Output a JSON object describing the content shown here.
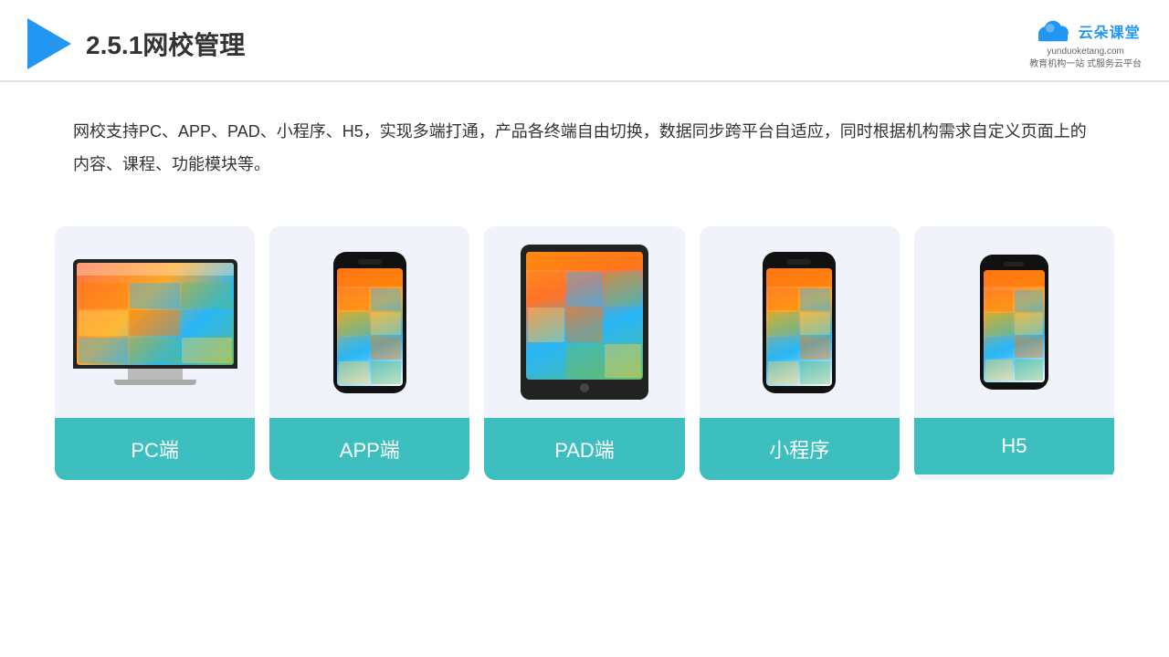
{
  "header": {
    "title": "2.5.1网校管理",
    "brand": {
      "name": "云朵课堂",
      "domain": "yunduoketang.com",
      "tagline": "教育机构一站\n式服务云平台"
    }
  },
  "description": {
    "text": "网校支持PC、APP、PAD、小程序、H5，实现多端打通，产品各终端自由切换，数据同步跨平台自适应，同时根据机构需求自定义页面上的内容、课程、功能模块等。"
  },
  "cards": [
    {
      "id": "pc",
      "label": "PC端"
    },
    {
      "id": "app",
      "label": "APP端"
    },
    {
      "id": "pad",
      "label": "PAD端"
    },
    {
      "id": "miniapp",
      "label": "小程序"
    },
    {
      "id": "h5",
      "label": "H5"
    }
  ]
}
